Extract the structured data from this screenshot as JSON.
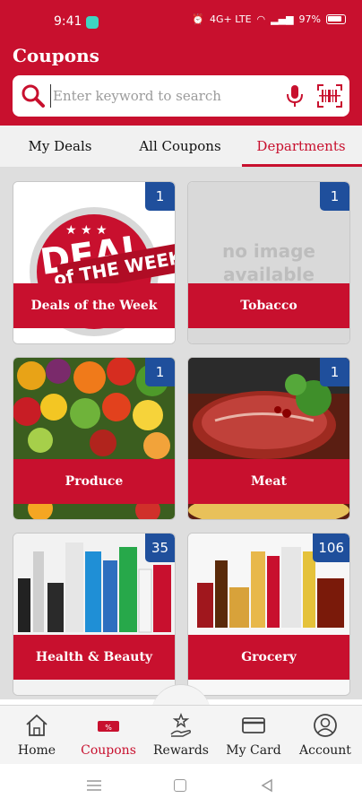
{
  "status_bar": {
    "time": "9:41",
    "battery": "97%",
    "network": "4G+ LTE"
  },
  "header": {
    "title": "Coupons"
  },
  "search": {
    "placeholder": "Enter keyword to search"
  },
  "tabs": [
    {
      "label": "My Deals",
      "active": false
    },
    {
      "label": "All Coupons",
      "active": false
    },
    {
      "label": "Departments",
      "active": true
    }
  ],
  "departments": [
    {
      "label": "Deals of the Week",
      "count": "1",
      "image": "deal-of-the-week-graphic",
      "image_text": [
        "DEAL",
        "of THE WEEK"
      ]
    },
    {
      "label": "Tobacco",
      "count": "1",
      "image": "no-image-placeholder",
      "image_text": [
        "no image",
        "available"
      ]
    },
    {
      "label": "Produce",
      "count": "1",
      "image": "produce-photo"
    },
    {
      "label": "Meat",
      "count": "1",
      "image": "meat-photo"
    },
    {
      "label": "Health & Beauty",
      "count": "35",
      "image": "health-beauty-photo"
    },
    {
      "label": "Grocery",
      "count": "106",
      "image": "grocery-photo"
    }
  ],
  "bottom_nav": [
    {
      "label": "Home",
      "icon": "home-icon",
      "active": false
    },
    {
      "label": "Coupons",
      "icon": "coupon-icon",
      "active": true
    },
    {
      "label": "Rewards",
      "icon": "rewards-icon",
      "active": false
    },
    {
      "label": "My Card",
      "icon": "card-icon",
      "active": false
    },
    {
      "label": "Account",
      "icon": "account-icon",
      "active": false
    }
  ],
  "colors": {
    "brand": "#c8102e",
    "badge": "#1f4f9c",
    "background": "#dedede"
  }
}
